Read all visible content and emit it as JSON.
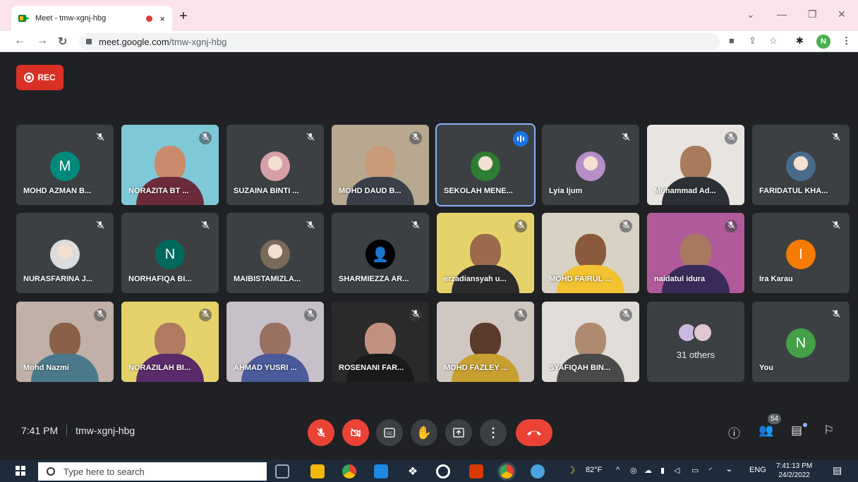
{
  "browser": {
    "tab_title": "Meet - tmw-xgnj-hbg",
    "tab_close": "×",
    "new_tab": "+",
    "url_host": "meet.google.com",
    "url_path": "/tmw-xgnj-hbg",
    "profile_initial": "N",
    "window_controls": [
      "⌄",
      "—",
      "❐",
      "✕"
    ]
  },
  "meet": {
    "rec_label": "REC",
    "others_label": "31 others",
    "meeting_time": "7:41 PM",
    "meeting_code": "tmw-xgnj-hbg",
    "participants_count": "54",
    "tiles": [
      {
        "name": "MOHD AZMAN B...",
        "type": "initial",
        "initial": "M",
        "color": "#00897b"
      },
      {
        "name": "NORAZITA BT ...",
        "type": "video",
        "bg": "#7fc8d8",
        "head": "#c98b6b",
        "body": "#6b2b3b"
      },
      {
        "name": "SUZAINA BINTI ...",
        "type": "photo",
        "photo": "#d7a0a8"
      },
      {
        "name": "MOHD DAUD B...",
        "type": "video",
        "bg": "#b8a890",
        "head": "#c99a78",
        "body": "#3a3f4a"
      },
      {
        "name": "SEKOLAH MENE...",
        "type": "photo",
        "photo": "#2e7d32",
        "active": true
      },
      {
        "name": "Lyia Ijum",
        "type": "photo",
        "photo": "#b48fc8"
      },
      {
        "name": "Muhammad Ad...",
        "type": "video",
        "bg": "#e8e4e0",
        "head": "#a77b5b",
        "body": "#2d3036"
      },
      {
        "name": "FARIDATUL KHA...",
        "type": "photo",
        "photo": "#4a6a8a"
      },
      {
        "name": "NURASFARINA J...",
        "type": "photo",
        "photo": "#dcdcdc"
      },
      {
        "name": "NORHAFIQA BI...",
        "type": "initial",
        "initial": "N",
        "color": "#00695c"
      },
      {
        "name": "MAIBISTAMIZLA...",
        "type": "photo",
        "photo": "#7a6a5a"
      },
      {
        "name": "SHARMIEZZA AR...",
        "type": "initial",
        "initial": "👤",
        "color": "#000000"
      },
      {
        "name": "erzadiansyah u...",
        "type": "video",
        "bg": "#e6d26a",
        "head": "#9b6a4a",
        "body": "#2c2c2c"
      },
      {
        "name": "MOHD FAIRUL ...",
        "type": "video",
        "bg": "#d8d2c4",
        "head": "#8a5a3c",
        "body": "#f2c230"
      },
      {
        "name": "naidatul idura",
        "type": "video",
        "bg": "#b05a9a",
        "head": "#a87a60",
        "body": "#3a2a5a"
      },
      {
        "name": "Ira Karau",
        "type": "initial",
        "initial": "I",
        "color": "#f57c00"
      },
      {
        "name": "Mohd Nazmi",
        "type": "video",
        "bg": "#c0b0a8",
        "head": "#8a6048",
        "body": "#4a7a8a"
      },
      {
        "name": "NORAZILAH BI...",
        "type": "video",
        "bg": "#e6d26a",
        "head": "#b07a60",
        "body": "#5a2a6a"
      },
      {
        "name": "AHMAD YUSRI ...",
        "type": "video",
        "bg": "#c8c0c8",
        "head": "#9a7060",
        "body": "#4a5a9a"
      },
      {
        "name": "ROSENANI FAR...",
        "type": "video",
        "bg": "#2a2a2a",
        "head": "#c09080",
        "body": "#1a1a1a"
      },
      {
        "name": "MOHD FAZLEY ...",
        "type": "video",
        "bg": "#d0c8c0",
        "head": "#5a3a2a",
        "body": "#c8a030"
      },
      {
        "name": "SYAFIQAH BIN...",
        "type": "video",
        "bg": "#e0dcd8",
        "head": "#b08a70",
        "body": "#4a4a4a"
      },
      {
        "name": "",
        "type": "others"
      },
      {
        "name": "You",
        "type": "initial",
        "initial": "N",
        "color": "#43a047"
      }
    ]
  },
  "taskbar": {
    "search_placeholder": "Type here to search",
    "weather": "82°F",
    "language": "ENG",
    "clock_time": "7:41:13 PM",
    "clock_date": "24/2/2022"
  }
}
